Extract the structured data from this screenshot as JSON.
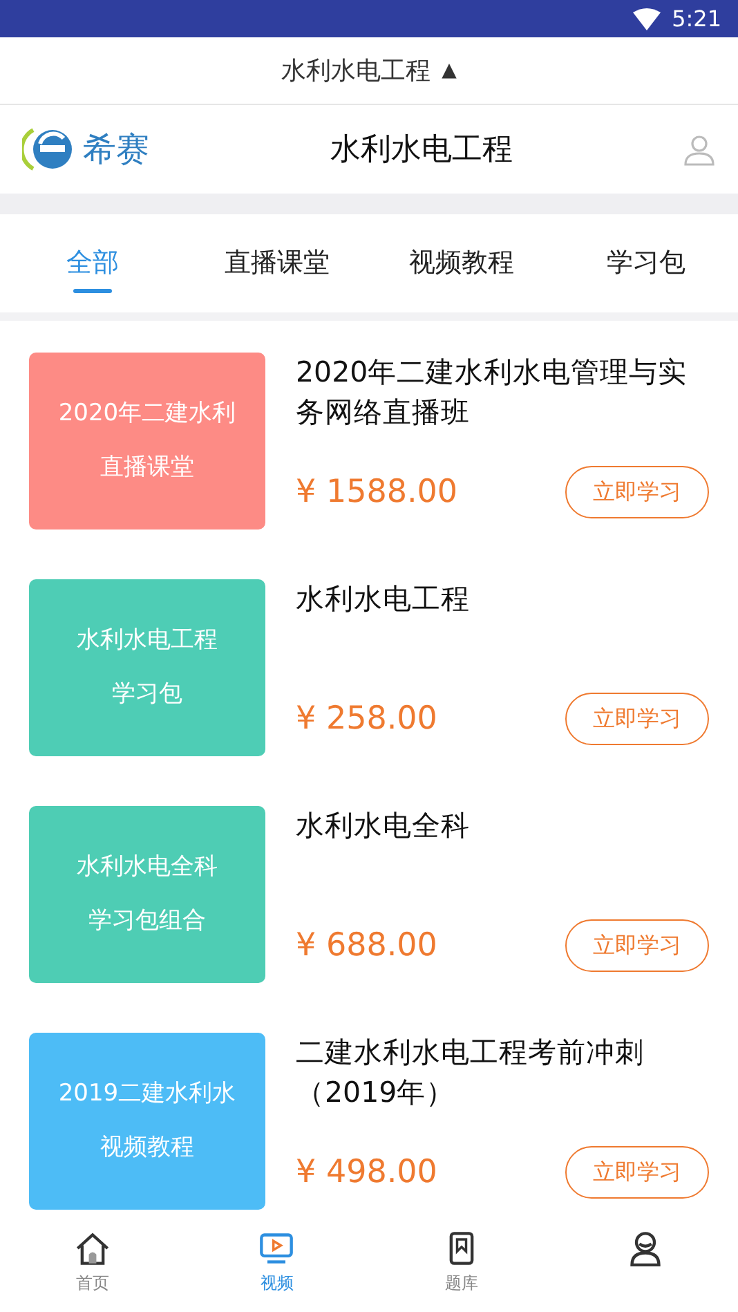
{
  "status_bar": {
    "time": "5:21"
  },
  "dropdown": {
    "label": "水利水电工程",
    "caret": "▲"
  },
  "header": {
    "brand": "希赛",
    "title": "水利水电工程"
  },
  "tabs": [
    {
      "label": "全部",
      "selected": true
    },
    {
      "label": "直播课堂",
      "selected": false
    },
    {
      "label": "视频教程",
      "selected": false
    },
    {
      "label": "学习包",
      "selected": false
    }
  ],
  "courses": [
    {
      "cover_lines": [
        "2020年二建水利",
        "直播课堂"
      ],
      "color": "#fd8b85",
      "title": "2020年二建水利水电管理与实务网络直播班",
      "price": "¥ 1588.00",
      "button": "立即学习"
    },
    {
      "cover_lines": [
        "水利水电工程",
        "学习包"
      ],
      "color": "#4ecdb5",
      "title": "水利水电工程",
      "price": "¥ 258.00",
      "button": "立即学习"
    },
    {
      "cover_lines": [
        "水利水电全科",
        "学习包组合"
      ],
      "color": "#4ecdb4",
      "title": "水利水电全科",
      "price": "¥ 688.00",
      "button": "立即学习"
    },
    {
      "cover_lines": [
        "2019二建水利水",
        "视频教程"
      ],
      "color": "#4dbcf6",
      "title": "二建水利水电工程考前冲刺（2019年）",
      "price": "¥ 498.00",
      "button": "立即学习"
    }
  ],
  "bottom_nav": [
    {
      "kind": "home",
      "label": "首页",
      "selected": false
    },
    {
      "kind": "video",
      "label": "视频",
      "selected": true
    },
    {
      "kind": "bank",
      "label": "题库",
      "selected": false
    },
    {
      "kind": "profile",
      "selected": false
    }
  ]
}
